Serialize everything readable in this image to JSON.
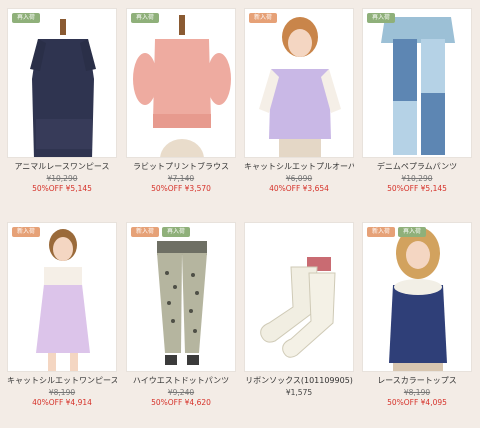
{
  "products": [
    {
      "name": "アニマルレースワンピース",
      "old_price": "¥10,290",
      "sale": "50%OFF ¥5,145",
      "badges": [
        {
          "type": "restock",
          "label": "再入荷"
        }
      ]
    },
    {
      "name": "ラビットプリントブラウス",
      "old_price": "¥7,140",
      "sale": "50%OFF ¥3,570",
      "badges": [
        {
          "type": "restock",
          "label": "再入荷"
        }
      ]
    },
    {
      "name": "キャットシルエットプルオーバー",
      "old_price": "¥6,090",
      "sale": "40%OFF ¥3,654",
      "badges": [
        {
          "type": "new",
          "label": "新入荷"
        }
      ]
    },
    {
      "name": "デニムペプラムパンツ",
      "old_price": "¥10,290",
      "sale": "50%OFF ¥5,145",
      "badges": [
        {
          "type": "restock",
          "label": "再入荷"
        }
      ]
    },
    {
      "name": "キャットシルエットワンピース",
      "old_price": "¥8,190",
      "sale": "40%OFF ¥4,914",
      "badges": [
        {
          "type": "new",
          "label": "新入荷"
        }
      ]
    },
    {
      "name": "ハイウエストドットパンツ",
      "old_price": "¥9,240",
      "sale": "50%OFF ¥4,620",
      "badges": [
        {
          "type": "new",
          "label": "新入荷"
        },
        {
          "type": "restock",
          "label": "再入荷"
        }
      ]
    },
    {
      "name": "リボンソックス(101109905)",
      "price": "¥1,575",
      "badges": []
    },
    {
      "name": "レースカラートップス",
      "old_price": "¥8,190",
      "sale": "50%OFF ¥4,095",
      "badges": [
        {
          "type": "new",
          "label": "新入荷"
        },
        {
          "type": "restock",
          "label": "再入荷"
        }
      ]
    }
  ],
  "colors": {
    "restock": "#8fb07a",
    "new": "#e6a177",
    "sale": "#d6322a"
  }
}
